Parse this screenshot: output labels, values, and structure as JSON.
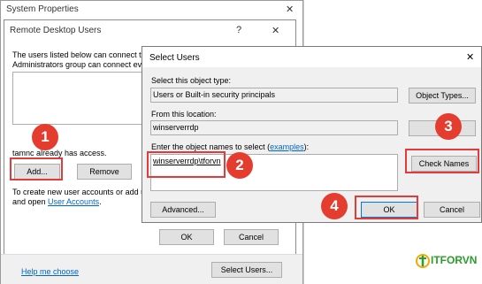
{
  "system_properties": {
    "title": "System Properties",
    "close_glyph": "✕"
  },
  "rdu": {
    "title": "Remote Desktop Users",
    "help_glyph": "?",
    "close_glyph": "✕",
    "desc_line1": "The users listed below can connect to",
    "desc_line2": "Administrators group can connect eve",
    "access_text": "tamnc already has access.",
    "add_label": "Add...",
    "remove_label": "Remove",
    "create_line1": "To create new user accounts or add us",
    "create_line2_prefix": "and open ",
    "user_accounts_link": "User Accounts",
    "create_line2_suffix": ".",
    "ok_label": "OK",
    "cancel_label": "Cancel"
  },
  "bottom": {
    "help_link": "Help me choose",
    "select_users_label": "Select Users..."
  },
  "select_users": {
    "title": "Select Users",
    "close_glyph": "✕",
    "object_type_label": "Select this object type:",
    "object_type_value": "Users or Built-in security principals",
    "object_types_button": "Object Types...",
    "location_label": "From this location:",
    "location_value": "winserverrdp",
    "locations_button": "Lo",
    "names_label_prefix": "Enter the object names to select (",
    "names_label_link": "examples",
    "names_label_suffix": "):",
    "names_value": "winserverrdp\\tforvn",
    "check_names_button": "Check Names",
    "advanced_button": "Advanced...",
    "ok_button": "OK",
    "cancel_button": "Cancel"
  },
  "steps": [
    "1",
    "2",
    "3",
    "4"
  ],
  "watermark": {
    "text": "ITFORVN"
  },
  "colors": {
    "accent_red": "#e43d30",
    "link_blue": "#0066cc",
    "dialog_border": "#7a7a7a"
  }
}
